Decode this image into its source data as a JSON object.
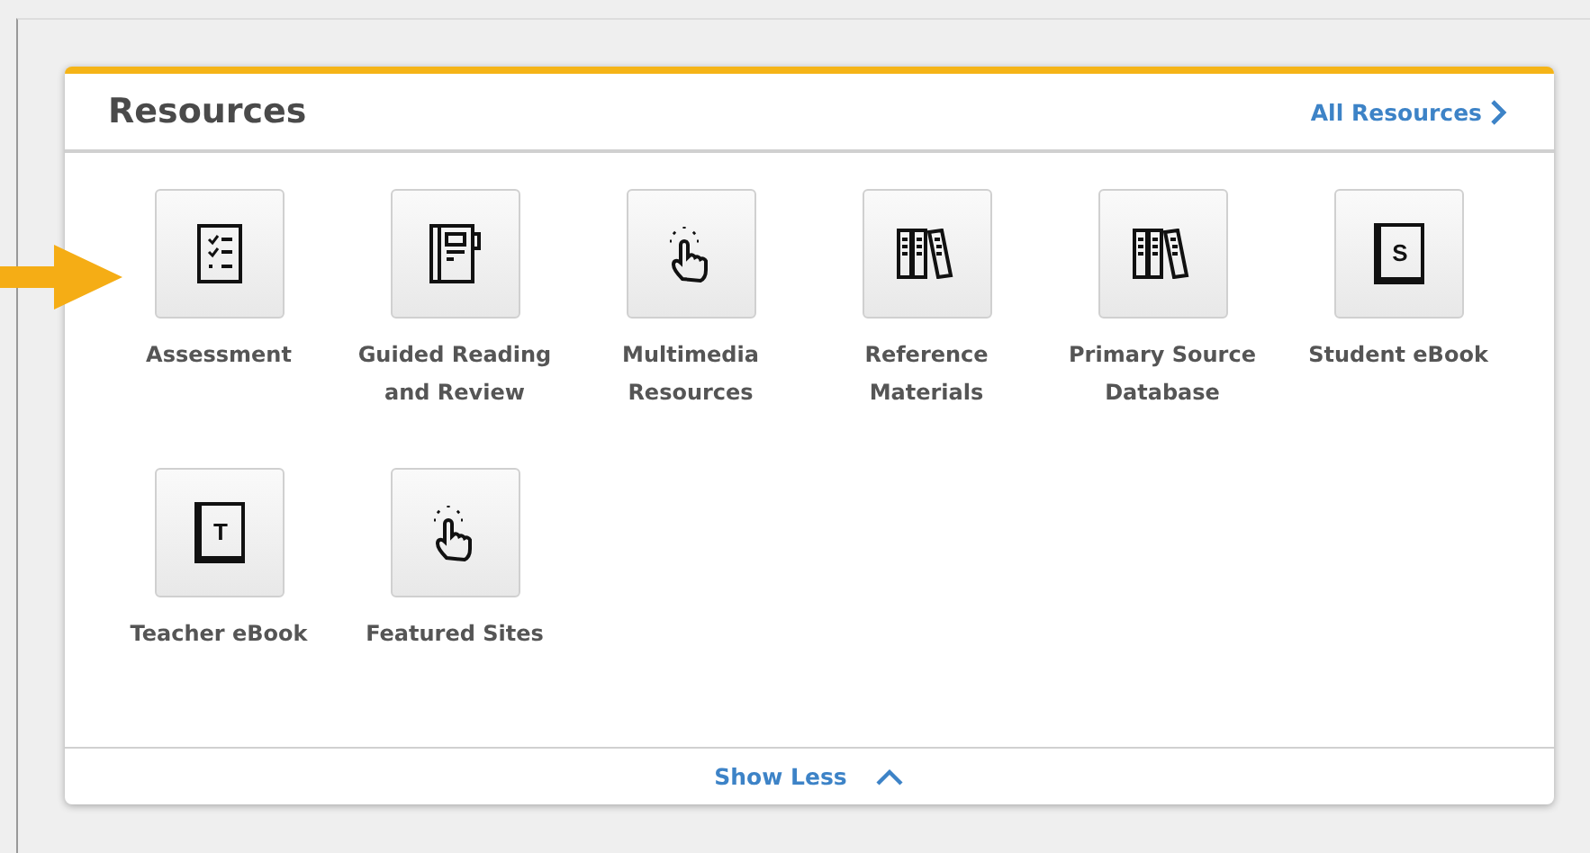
{
  "panel": {
    "title": "Resources",
    "link": "All Resources"
  },
  "resources": [
    {
      "label": "Assessment",
      "kind": "checklist"
    },
    {
      "label": "Guided Reading and Review",
      "kind": "notebook"
    },
    {
      "label": "Multimedia Resources",
      "kind": "touch"
    },
    {
      "label": "Reference Materials",
      "kind": "books"
    },
    {
      "label": "Primary Source Database",
      "kind": "books"
    },
    {
      "label": "Student eBook",
      "kind": "ebook",
      "letter": "S"
    },
    {
      "label": "Teacher eBook",
      "kind": "ebook",
      "letter": "T"
    },
    {
      "label": "Featured Sites",
      "kind": "touch"
    }
  ],
  "footer": {
    "toggle": "Show Less"
  }
}
